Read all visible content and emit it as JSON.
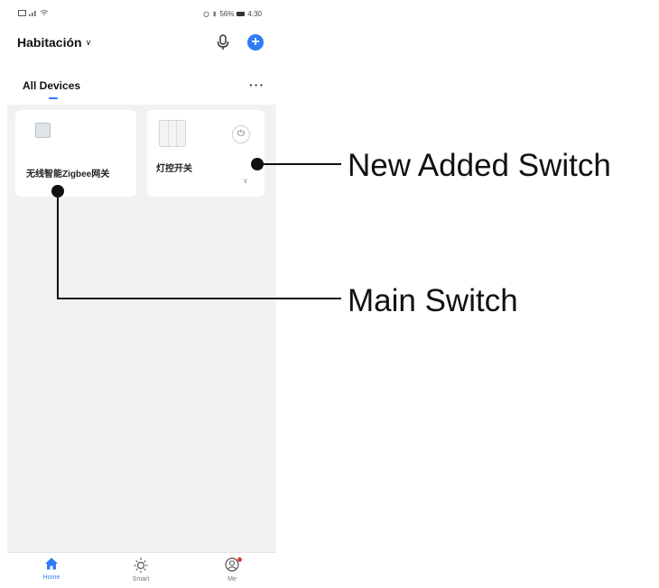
{
  "status_bar": {
    "left_text": "\"▐▐ ᴵ",
    "right_text": "56% ▐ 4:30"
  },
  "header": {
    "home_name": "Habitación",
    "chevron": "∨",
    "add_symbol": "+"
  },
  "tabs": {
    "all_devices": "All Devices",
    "more": "···"
  },
  "devices": [
    {
      "name": "无线智能Zigbee网关",
      "icon": "gateway-icon"
    },
    {
      "name": "灯控开关",
      "icon": "switch-icon",
      "power_symbol": "⏻",
      "expand": "∨"
    }
  ],
  "tab_bar": [
    {
      "label": "Home",
      "icon": "home-icon",
      "active": true
    },
    {
      "label": "Smart",
      "icon": "sun-icon",
      "active": false
    },
    {
      "label": "Me",
      "icon": "user-icon",
      "active": false,
      "badge": true
    }
  ],
  "annotations": {
    "new_added_switch": "New Added Switch",
    "main_switch": "Main Switch"
  },
  "colors": {
    "accent": "#2f7bf5",
    "background": "#f2f2f2",
    "badge": "#e53935"
  }
}
